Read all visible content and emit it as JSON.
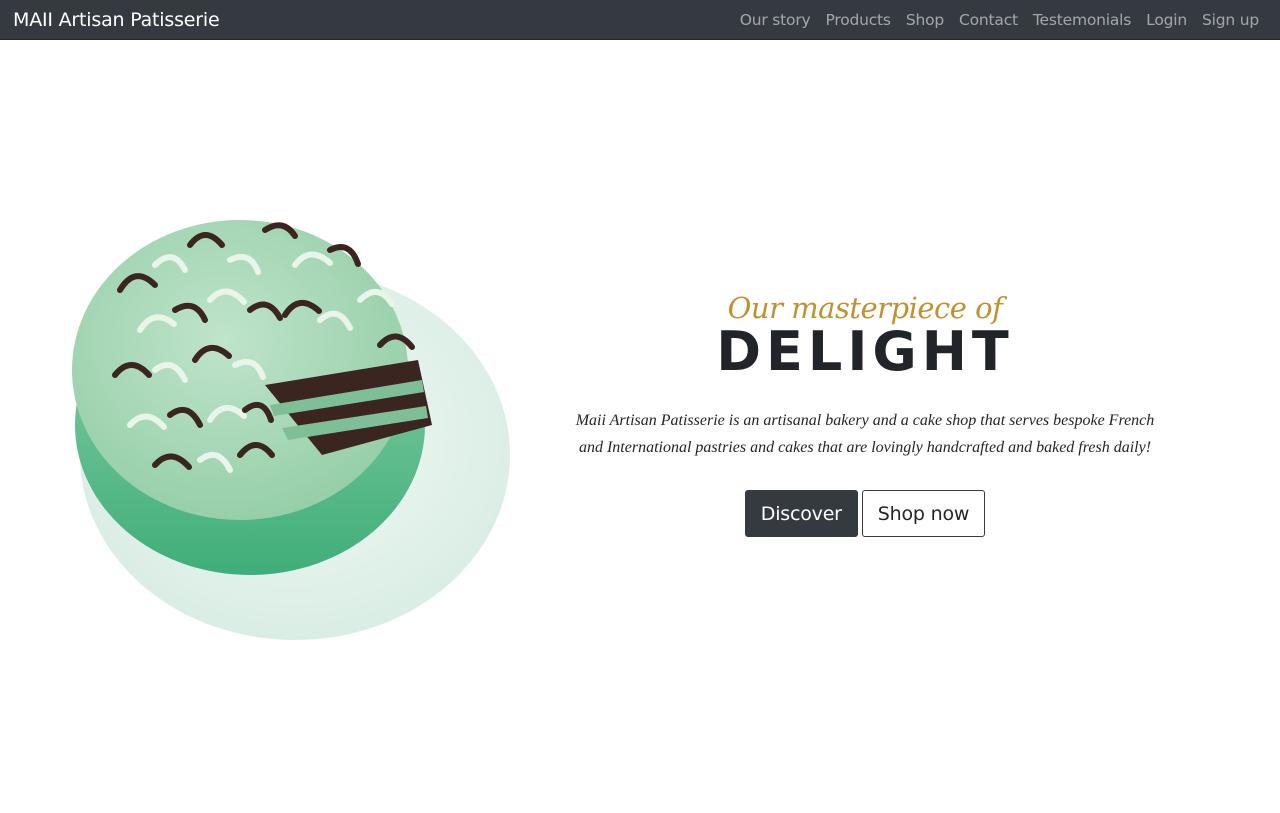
{
  "navbar": {
    "brand": "MAII Artisan Patisserie",
    "links": [
      "Our story",
      "Products",
      "Shop",
      "Contact",
      "Testemonials",
      "Login",
      "Sign up"
    ]
  },
  "hero": {
    "eyebrow": "Our masterpiece of",
    "headline": "DELIGHT",
    "description": "Maii Artisan Patisserie is an artisanal bakery and a cake shop that serves bespoke French and International pastries and cakes that are lovingly handcrafted and baked fresh daily!",
    "buttons": {
      "discover": "Discover",
      "shop_now": "Shop now"
    }
  },
  "colors": {
    "navbar_bg": "#343a40",
    "accent_gold": "#c0922f",
    "frosting": "#a8d8b9",
    "plate": "#e9f4ef"
  },
  "image": {
    "subject": "mint chocolate layer cake on plate"
  }
}
